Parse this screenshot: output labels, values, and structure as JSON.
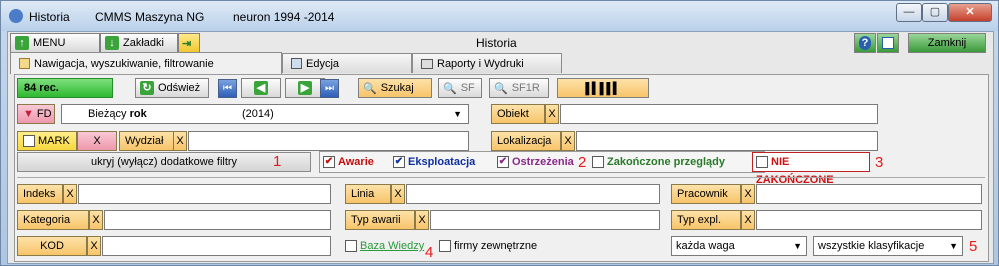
{
  "titlebar": {
    "app": "Historia",
    "db": "CMMS Maszyna NG",
    "user": "neuron 1994 -2014",
    "minimize": "—",
    "maximize": "▢",
    "close": "✕"
  },
  "toolbar": {
    "menu": "MENU",
    "bookmarks": "Zakładki",
    "title": "Historia",
    "close": "Zamknij"
  },
  "tabs": [
    "Nawigacja, wyszukiwanie, filtrowanie",
    "Edycja",
    "Raporty i Wydruki"
  ],
  "row1": {
    "count": "84 rec.",
    "refresh": "Odśwież",
    "search": "Szukaj",
    "sf": "SF",
    "sf1r": "SF1R"
  },
  "filter": {
    "fd": "FD",
    "period": "Bieżący",
    "period_bold": "rok",
    "year": "(2014)",
    "obiekt": "Obiekt",
    "mark": "MARK",
    "x": "X",
    "wydzial": "Wydział",
    "lokalizacja": "Lokalizacja"
  },
  "hide_filters": "ukryj (wyłącz) dodatkowe filtry",
  "checks": {
    "awarie": "Awarie",
    "eksploatacja": "Eksploatacja",
    "ostrzezenia": "Ostrzeżenia",
    "zakonczone": "Zakończone przeglądy",
    "nie_zakonczone": "NIE ZAKOŃCZONE"
  },
  "fields": {
    "indeks": "Indeks",
    "linia": "Linia",
    "pracownik": "Pracownik",
    "kategoria": "Kategoria",
    "typ_awarii": "Typ awarii",
    "typ_expl": "Typ expl.",
    "kod": "KOD"
  },
  "bottom": {
    "baza": "Baza Wiedzy",
    "firmy": "firmy zewnętrzne",
    "waga": "każda waga",
    "klasyfikacje": "wszystkie klasyfikacje"
  },
  "markers": [
    "1",
    "2",
    "3",
    "4",
    "5"
  ],
  "colors": {
    "red": "#e31b1b",
    "green": "#3aa43a",
    "orange": "#f7c46a"
  }
}
